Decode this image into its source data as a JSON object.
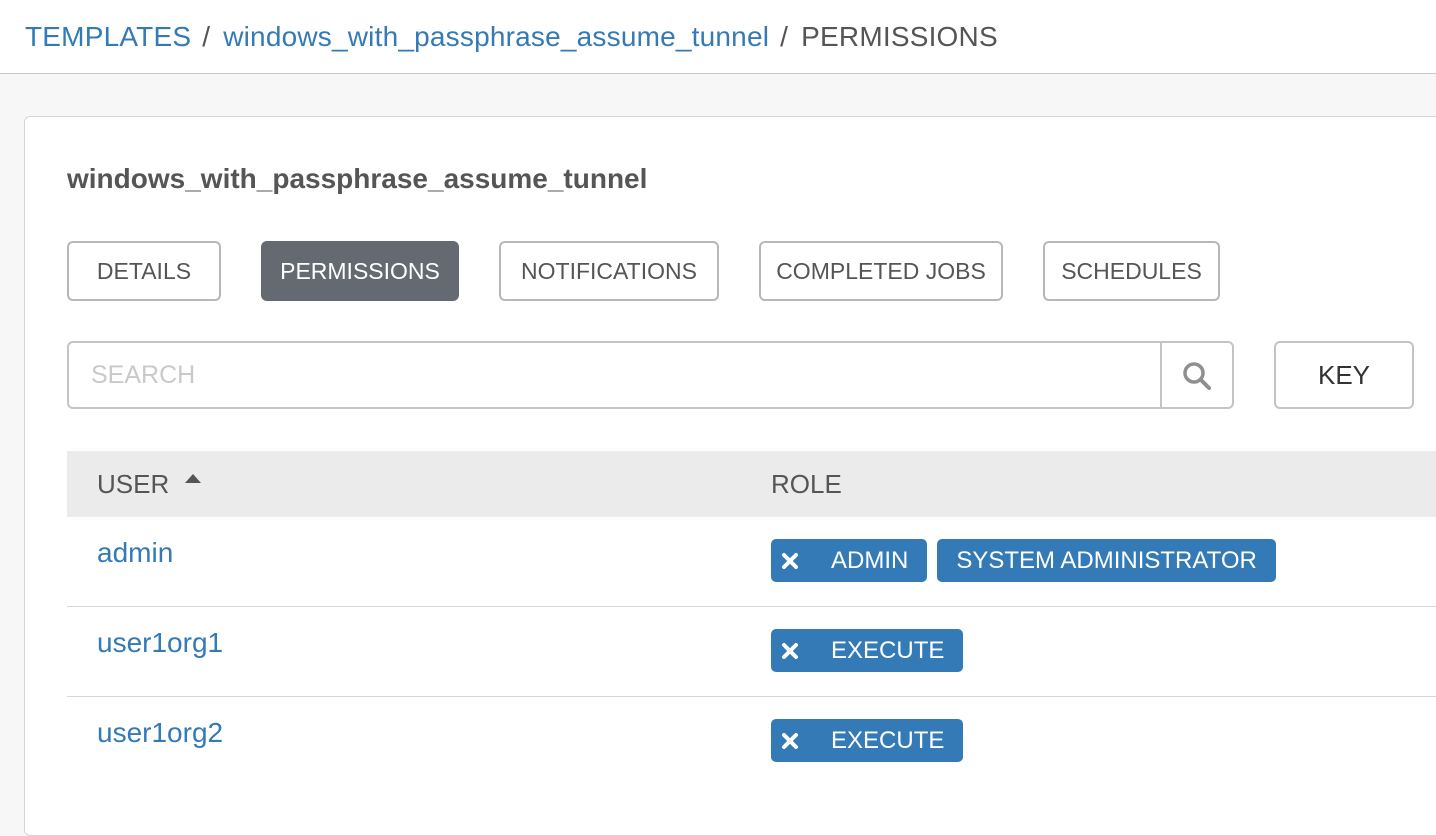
{
  "breadcrumb": {
    "templates": "TEMPLATES",
    "separator": "/",
    "template_name": "windows_with_passphrase_assume_tunnel",
    "current": "PERMISSIONS"
  },
  "panel": {
    "title": "windows_with_passphrase_assume_tunnel"
  },
  "tabs": [
    {
      "label": "DETAILS",
      "active": false
    },
    {
      "label": "PERMISSIONS",
      "active": true
    },
    {
      "label": "NOTIFICATIONS",
      "active": false
    },
    {
      "label": "COMPLETED JOBS",
      "active": false
    },
    {
      "label": "SCHEDULES",
      "active": false
    }
  ],
  "search": {
    "placeholder": "SEARCH",
    "value": "",
    "icon": "search-icon"
  },
  "key_button": "KEY",
  "table": {
    "columns": {
      "user": "USER",
      "role": "ROLE",
      "sort": "ascending"
    },
    "rows": [
      {
        "user": "admin",
        "roles": [
          {
            "label": "ADMIN",
            "removable": true
          },
          {
            "label": "SYSTEM ADMINISTRATOR",
            "removable": false
          }
        ]
      },
      {
        "user": "user1org1",
        "roles": [
          {
            "label": "EXECUTE",
            "removable": true
          }
        ]
      },
      {
        "user": "user1org2",
        "roles": [
          {
            "label": "EXECUTE",
            "removable": true
          }
        ]
      }
    ]
  },
  "colors": {
    "link": "#337ab7",
    "chip": "#337ab7",
    "active_tab": "#646972"
  }
}
